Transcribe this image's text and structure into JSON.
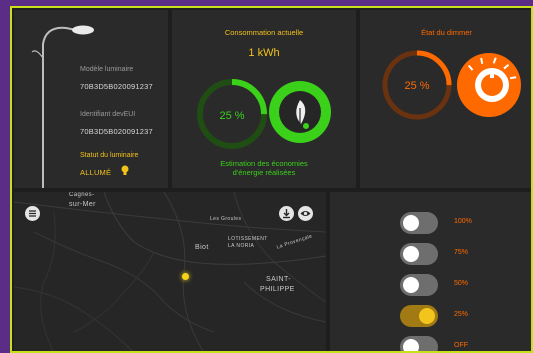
{
  "lamp": {
    "model_label": "Modèle luminaire",
    "model_value": "70B3D5B020091237",
    "dev_label": "Identifiant devEUI",
    "dev_value": "70B3D5B020091237",
    "status_label": "Statut du luminaire",
    "status_value": "ALLUMÉ"
  },
  "consumption": {
    "title": "Consommation actuelle",
    "value": "1 kWh",
    "percent_label": "25 %",
    "percent": 25,
    "caption_line1": "Estimation des économies",
    "caption_line2": "d'énergie réalisées",
    "color": "#3bd11a"
  },
  "dimmer": {
    "title": "État du dimmer",
    "percent_label": "25 %",
    "percent": 25,
    "color": "#ff6a00"
  },
  "map": {
    "labels": {
      "cagnes": "Cagnes-",
      "sur_mer": "sur-Mer",
      "les_groules": "Les Groules",
      "biot": "Biot",
      "lotissement": "LOTISSEMENT",
      "la_noria": "LA NORIA",
      "la_provencale": "La Provençale",
      "saint": "SAINT-",
      "philippe": "PHILIPPE"
    },
    "icons": [
      "menu-icon",
      "download-icon",
      "eye-icon"
    ]
  },
  "toggles": [
    {
      "label": "100%",
      "on": false
    },
    {
      "label": "75%",
      "on": false
    },
    {
      "label": "50%",
      "on": false
    },
    {
      "label": "25%",
      "on": true
    },
    {
      "label": "OFF",
      "on": false
    }
  ]
}
